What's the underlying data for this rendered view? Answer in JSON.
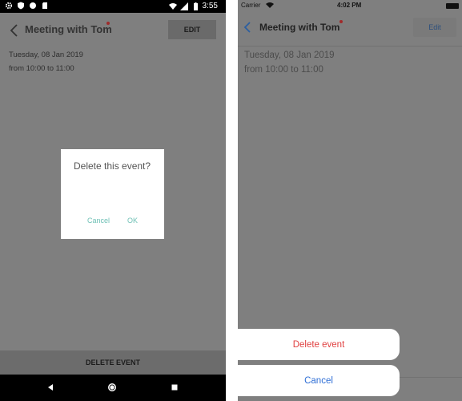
{
  "android": {
    "status_bar": {
      "icons": [
        "settings-icon",
        "shield-icon",
        "circle-icon",
        "sd-card-icon"
      ],
      "right_icons": [
        "wifi-icon",
        "signal-icon",
        "battery-icon"
      ],
      "time": "3:55"
    },
    "toolbar": {
      "title": "Meeting with Tom",
      "edit_label": "EDIT",
      "unsaved_dot_color": "#9e2b2b"
    },
    "event": {
      "date": "Tuesday, 08 Jan 2019",
      "time_range": "from 10:00 to 11:00"
    },
    "dialog": {
      "message": "Delete this event?",
      "cancel_label": "Cancel",
      "ok_label": "OK",
      "accent_color": "#6fc1b6"
    },
    "delete_bar_label": "DELETE EVENT",
    "nav_bar": {
      "buttons": [
        "back-triangle-icon",
        "home-circle-icon",
        "recents-square-icon"
      ]
    }
  },
  "ios": {
    "status_bar": {
      "carrier": "Carrier",
      "time": "4:02 PM"
    },
    "nav": {
      "title": "Meeting with Tom",
      "edit_label": "Edit",
      "unsaved_dot_color": "#a02a2a"
    },
    "event": {
      "date": "Tuesday, 08 Jan 2019",
      "time_range": "from 10:00 to 11:00"
    },
    "action_sheet": {
      "delete_label": "Delete event",
      "cancel_label": "Cancel",
      "delete_color": "#e04040",
      "cancel_color": "#2f6fd6"
    }
  }
}
